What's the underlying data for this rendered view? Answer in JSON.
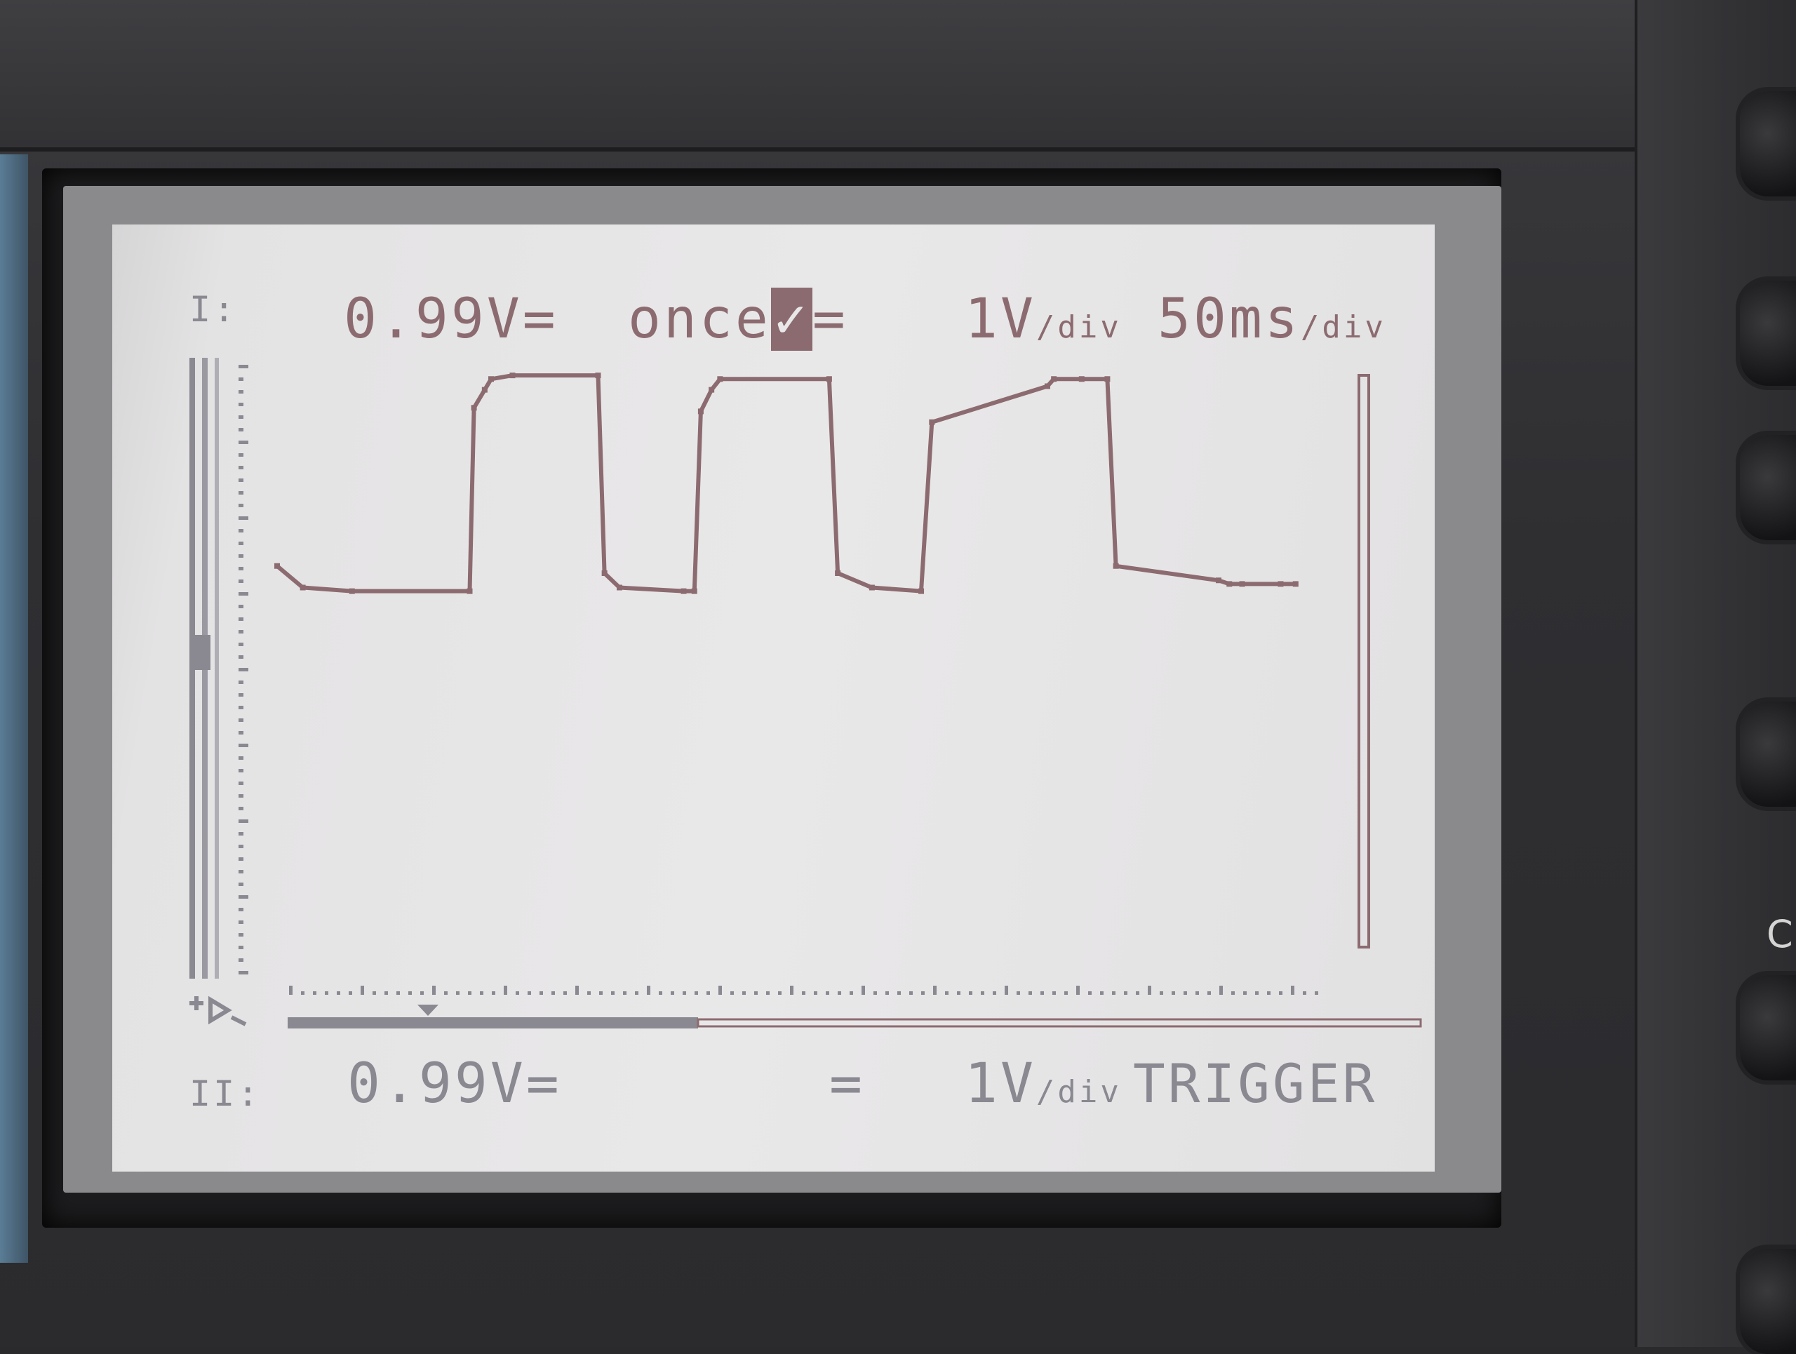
{
  "ch1": {
    "label": "I:",
    "reading": "0.99V=",
    "mode": "once",
    "mode_cursor": "✓",
    "mode_suffix": "=",
    "volts_per_div_value": "1V",
    "volts_per_div_unit": "/div",
    "time_per_div_value": "50ms",
    "time_per_div_unit": "/div"
  },
  "ch2": {
    "label": "II:",
    "reading": "0.99V=",
    "coupling": "=",
    "volts_per_div_value": "1V",
    "volts_per_div_unit": "/div",
    "status": "TRIGGER"
  },
  "trigger_icon": "trigger-icon",
  "colors": {
    "trace": "#8c6b70",
    "grey_trace": "#7d7a85",
    "lcd_bg": "#e9e8e9"
  },
  "chart_data": {
    "type": "line",
    "title": "",
    "xlabel": "",
    "ylabel": "",
    "x_units": "ms",
    "y_units": "V",
    "xlim": [
      0,
      500
    ],
    "ylim": [
      -5,
      3
    ],
    "grid": false,
    "series": [
      {
        "values_x": [
          0,
          12,
          35,
          90,
          92,
          97,
          100,
          110,
          150,
          153,
          160,
          190,
          195,
          198,
          203,
          207,
          258,
          262,
          278,
          301,
          306,
          360,
          363,
          376,
          388,
          392,
          440,
          445,
          451,
          469,
          476
        ],
        "values_y": [
          0.3,
          0.0,
          -0.05,
          -0.05,
          2.5,
          2.75,
          2.9,
          2.95,
          2.95,
          0.2,
          0.0,
          -0.05,
          -0.05,
          2.45,
          2.75,
          2.9,
          2.9,
          0.2,
          0.0,
          -0.05,
          2.3,
          2.8,
          2.9,
          2.9,
          2.9,
          0.3,
          0.1,
          0.05,
          0.05,
          0.05,
          0.05
        ]
      }
    ]
  }
}
